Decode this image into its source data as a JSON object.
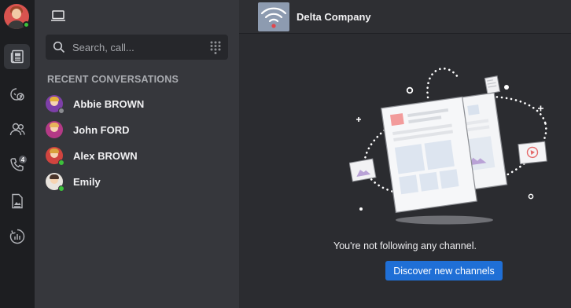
{
  "rail": {
    "notification_count": "4",
    "icons": [
      "user-avatar",
      "news-icon",
      "integrations-icon",
      "contacts-icon",
      "phone-icon",
      "documents-icon",
      "analytics-icon"
    ]
  },
  "panel": {
    "top_icon": "laptop-icon",
    "search": {
      "placeholder": "Search, call..."
    },
    "section_title": "RECENT CONVERSATIONS",
    "conversations": [
      {
        "name": "Abbie BROWN",
        "status": "offline",
        "status_color": "#8a8c91"
      },
      {
        "name": "John FORD",
        "status": "none",
        "status_color": ""
      },
      {
        "name": "Alex BROWN",
        "status": "online",
        "status_color": "#3cc13b"
      },
      {
        "name": "Emily",
        "status": "online",
        "status_color": "#3cc13b"
      }
    ]
  },
  "main": {
    "channel_name": "Delta Company",
    "empty_message": "You're not following any channel.",
    "discover_label": "Discover new channels"
  },
  "colors": {
    "accent": "#1f6fd6",
    "online": "#3cc13b",
    "rail_bg": "#1d1e21",
    "panel_bg": "#36373c",
    "main_bg": "#2b2c30"
  }
}
